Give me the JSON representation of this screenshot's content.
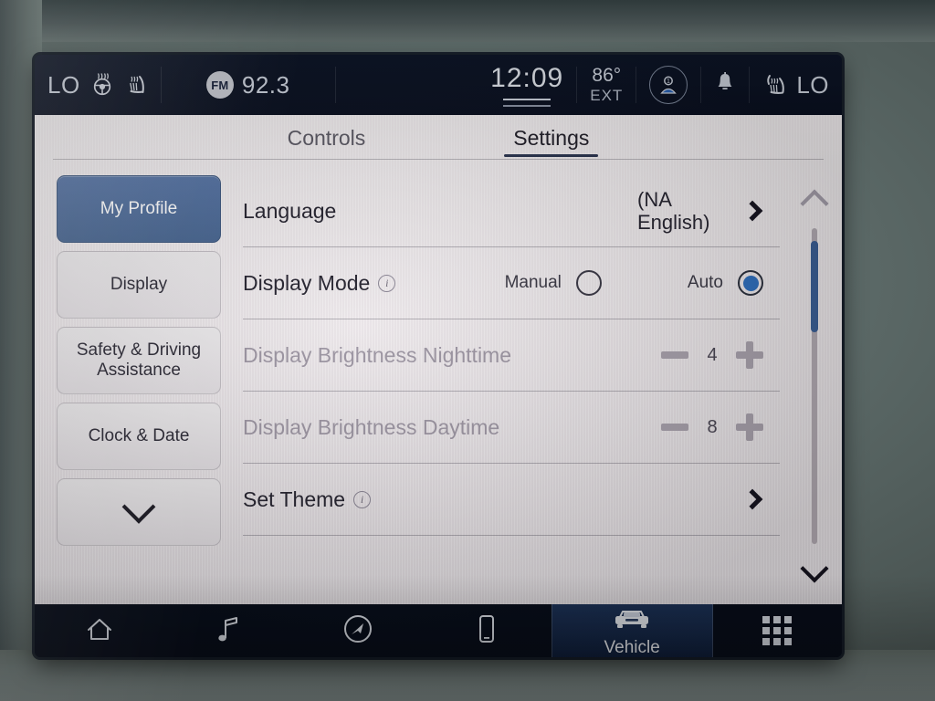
{
  "status_bar": {
    "left_climate_temp": "LO",
    "heated_wheel_icon": "heated-steering-wheel-icon",
    "heated_seat_left_icon": "heated-seat-icon",
    "radio_band": "FM",
    "radio_frequency": "92.3",
    "clock": "12:09",
    "exterior_temp": "86°",
    "exterior_label": "EXT",
    "profile_icon": "driver-profile-icon",
    "notification_icon": "bell-icon",
    "heated_seat_right_icon": "heated-seat-icon",
    "right_climate_temp": "LO"
  },
  "tabs": [
    {
      "label": "Controls",
      "active": false
    },
    {
      "label": "Settings",
      "active": true
    }
  ],
  "sidebar": {
    "items": [
      {
        "label": "My Profile",
        "selected": true
      },
      {
        "label": "Display",
        "selected": false
      },
      {
        "label": "Safety & Driving Assistance",
        "selected": false
      },
      {
        "label": "Clock & Date",
        "selected": false
      }
    ],
    "more_icon": "chevron-down-icon"
  },
  "settings": {
    "rows": [
      {
        "label": "Language",
        "value_line1": "(NA",
        "value_line2": "English)",
        "control": "chevron",
        "disabled": false
      },
      {
        "label": "Display Mode",
        "has_info": true,
        "control": "radio",
        "options": [
          {
            "label": "Manual",
            "selected": false
          },
          {
            "label": "Auto",
            "selected": true
          }
        ],
        "disabled": false
      },
      {
        "label": "Display Brightness Nighttime",
        "control": "stepper",
        "value": "4",
        "minus_icon": "minus-icon",
        "plus_icon": "plus-icon",
        "disabled": true
      },
      {
        "label": "Display Brightness Daytime",
        "control": "stepper",
        "value": "8",
        "minus_icon": "minus-icon",
        "plus_icon": "plus-icon",
        "disabled": true
      },
      {
        "label": "Set Theme",
        "has_info": true,
        "control": "chevron",
        "disabled": false
      }
    ]
  },
  "scrollbar": {
    "up_icon": "chevron-up-icon",
    "down_icon": "chevron-down-icon",
    "thumb_position_percent": 4
  },
  "nav_bar": {
    "items": [
      {
        "icon": "home-icon",
        "label": "",
        "active": false
      },
      {
        "icon": "music-note-icon",
        "label": "",
        "active": false
      },
      {
        "icon": "navigation-compass-icon",
        "label": "",
        "active": false
      },
      {
        "icon": "phone-icon",
        "label": "",
        "active": false
      },
      {
        "icon": "vehicle-truck-icon",
        "label": "Vehicle",
        "active": true
      },
      {
        "icon": "apps-grid-icon",
        "label": "",
        "active": false
      }
    ]
  },
  "colors": {
    "accent_blue": "#2f6fbe",
    "selected_sidebar": "#46648f",
    "panel_bg": "#ece7ea",
    "status_bar_bg": "#0a1020",
    "nav_bar_bg": "#080e1b"
  }
}
